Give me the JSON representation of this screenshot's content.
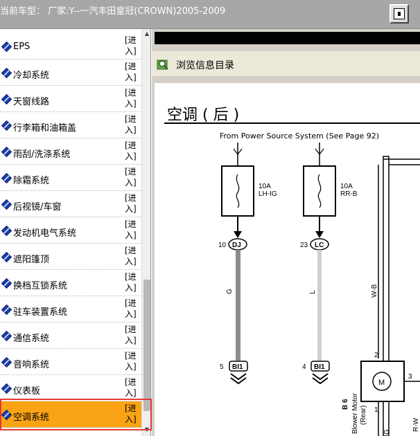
{
  "window": {
    "caption": "当前车型：  厂家:Y--一汽丰田皇冠(CROWN)2005-2009"
  },
  "sidebar": {
    "enter_label": "[进入]",
    "items": [
      {
        "label": "EPS"
      },
      {
        "label": "冷却系统"
      },
      {
        "label": "天窗线路"
      },
      {
        "label": "行李箱和油箱盖"
      },
      {
        "label": "雨刮/洗涤系统"
      },
      {
        "label": "除霜系统"
      },
      {
        "label": "后视镜/车窗"
      },
      {
        "label": "发动机电气系统"
      },
      {
        "label": "遮阳篷顶"
      },
      {
        "label": "换档互锁系统"
      },
      {
        "label": "驻车装置系统"
      },
      {
        "label": "通信系统"
      },
      {
        "label": "音响系统"
      },
      {
        "label": "仪表板"
      },
      {
        "label": "空调系统",
        "selected": true
      }
    ]
  },
  "toolbar": {
    "browse_label": "浏览信息目录"
  },
  "document": {
    "title": "空调 ( 后 )",
    "source_note": "From Power Source System (See Page 92)",
    "fuse1": {
      "rating": "10A",
      "name": "LH-IG"
    },
    "fuse2": {
      "rating": "10A",
      "name": "RR-B"
    },
    "conn1_pin": "10",
    "conn1_id": "DJ",
    "conn2_pin": "23",
    "conn2_id": "LC",
    "wire1_color": "G",
    "wire2_color": "L",
    "wire3_color": "W-B",
    "bi1_pin_a": "5",
    "bi1_pin_b": "4",
    "bi1_id": "BI1",
    "motor_pin_top": "2",
    "motor_pin_side": "3",
    "motor_pin_bottom": "1",
    "motor_symbol": "M",
    "motor_code": "B 6",
    "motor_name": "Blower Motor",
    "motor_side": "(Rear)",
    "bottom_wire": "R-W",
    "bottom_letter": "G"
  },
  "colors": {
    "title_bar": "#a7a7a7",
    "selected_row": "#f9a315",
    "highlight_border": "#e53935",
    "bullet_blue": "#1a3fb0"
  }
}
